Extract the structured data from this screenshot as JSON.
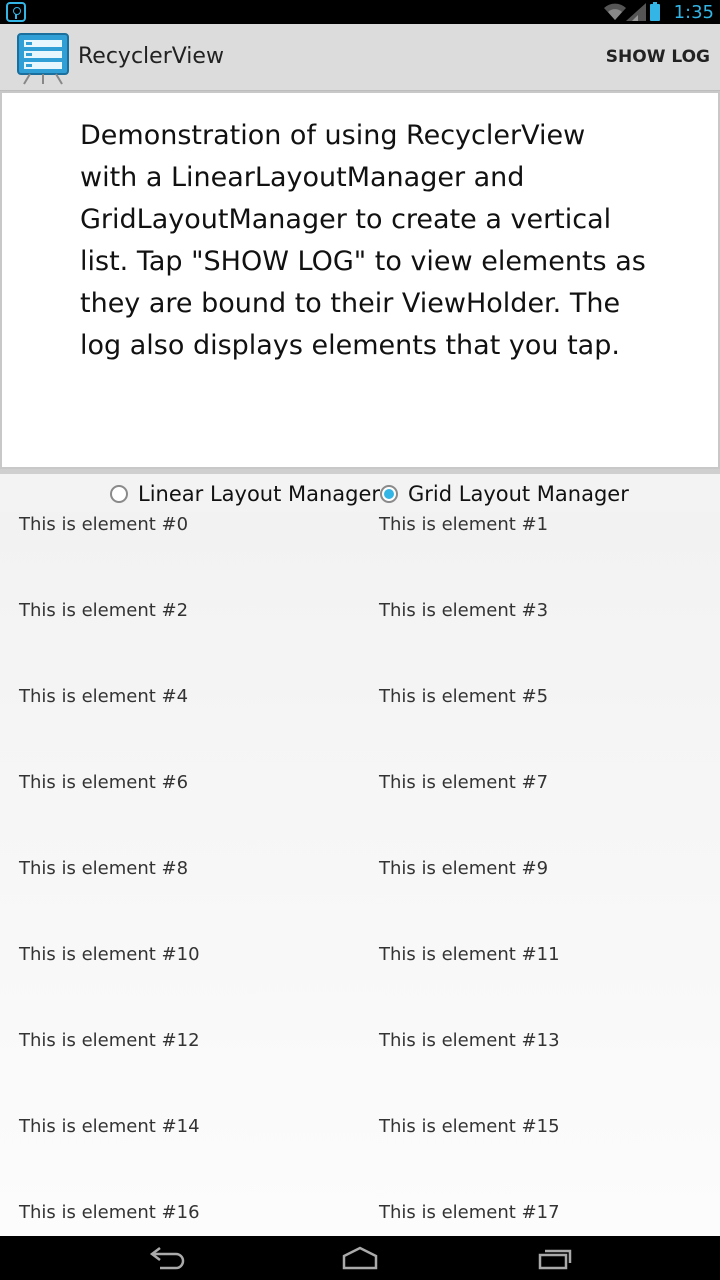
{
  "status_bar": {
    "time": "1:35",
    "accent_color": "#33b5e5",
    "icons": [
      "notification-icon",
      "wifi-icon",
      "signal-icon",
      "battery-icon"
    ]
  },
  "action_bar": {
    "title": "RecyclerView",
    "show_log_label": "SHOW LOG"
  },
  "description": {
    "text": "Demonstration of using RecyclerView\nwith a LinearLayoutManager and\nGridLayoutManager to create a vertical\nlist. Tap \"SHOW LOG\" to view elements as\nthey are bound to their ViewHolder. The\nlog also displays elements that you tap."
  },
  "layout_options": {
    "linear_label": "Linear Layout Manager",
    "grid_label": "Grid Layout Manager",
    "selected": "grid"
  },
  "elements": [
    "This is element #0",
    "This is element #1",
    "This is element #2",
    "This is element #3",
    "This is element #4",
    "This is element #5",
    "This is element #6",
    "This is element #7",
    "This is element #8",
    "This is element #9",
    "This is element #10",
    "This is element #11",
    "This is element #12",
    "This is element #13",
    "This is element #14",
    "This is element #15",
    "This is element #16",
    "This is element #17"
  ],
  "nav_bar": {
    "buttons": [
      "back-icon",
      "home-icon",
      "recents-icon"
    ]
  }
}
